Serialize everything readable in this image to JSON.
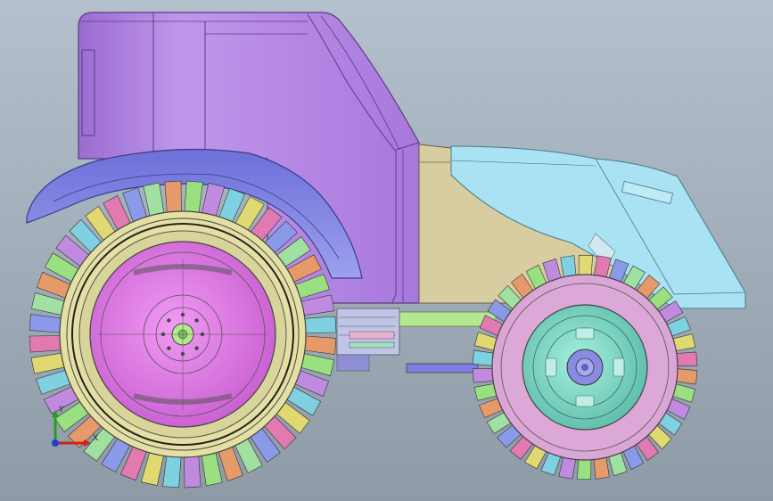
{
  "viewport": {
    "title": "",
    "background_top": "#b4c0cc",
    "background_bottom": "#8e9aa6"
  },
  "model": {
    "colors": {
      "cab": "#b07fe0",
      "cab_edge": "#7a4fa8",
      "fender": "#8c8ee8",
      "hood": "#a9e2f2",
      "engine_block": "#d8cda0",
      "rear_rim": "#e07ae6",
      "rear_tire_band": "#e2e0a0",
      "front_rim": "#7fd8c4",
      "front_ring": "#d9a6d6",
      "frame": "#b4e890"
    },
    "tread_palette": [
      "#e69a6a",
      "#9adf80",
      "#c08ae0",
      "#7fd0e0",
      "#e0d870",
      "#e07ab0",
      "#8a9ae8",
      "#a0e0a0"
    ]
  },
  "triad": {
    "x_label": "X",
    "y_label": "Y",
    "icon": "coordinate-triad-icon"
  }
}
